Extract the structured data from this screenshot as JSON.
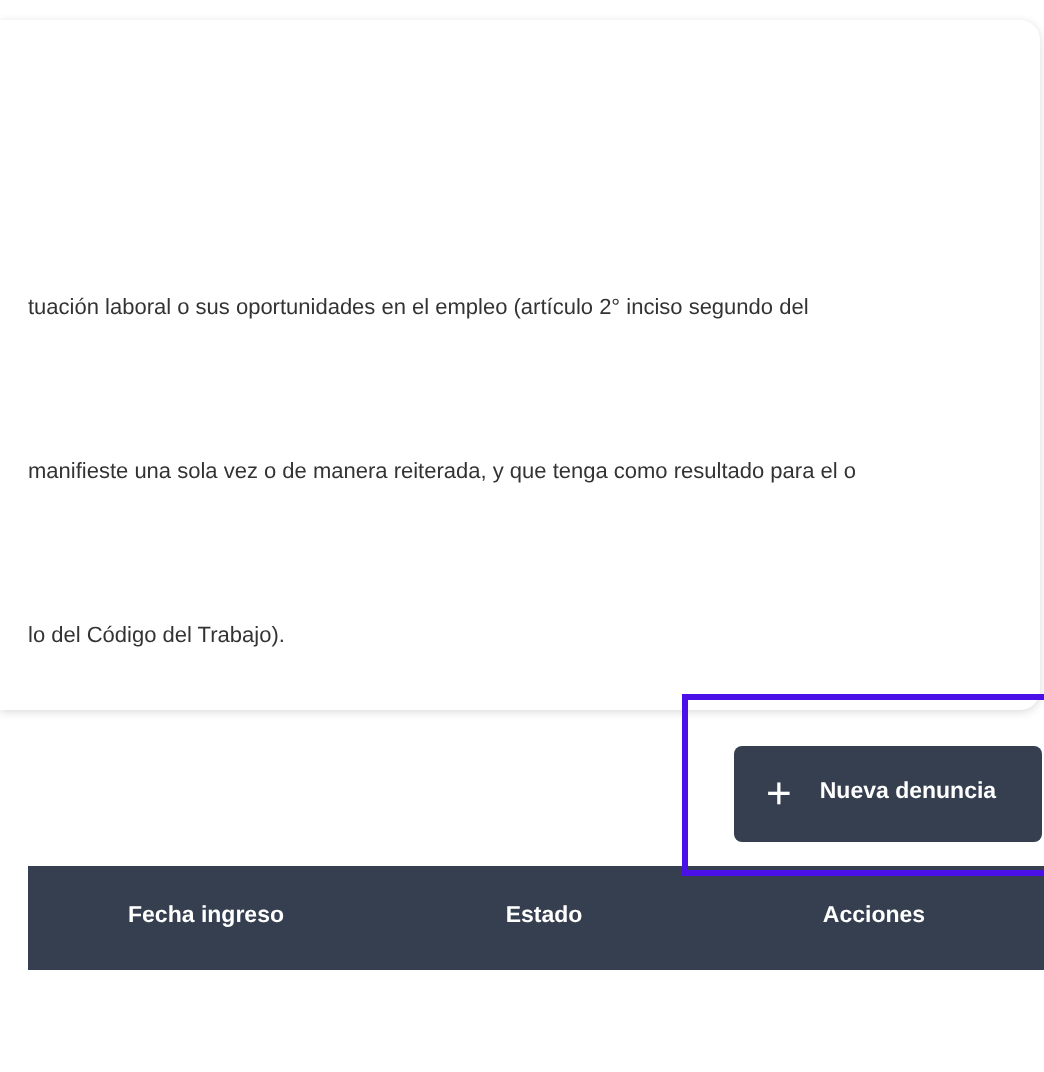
{
  "info_card": {
    "paragraphs": [
      "tuación laboral o sus oportunidades en el empleo (artículo 2° inciso segundo del",
      "manifieste una sola vez o de manera reiterada, y que tenga como resultado para el o",
      "lo del Código del Trabajo)."
    ]
  },
  "new_button": {
    "icon": "+",
    "label": "Nueva denuncia",
    "highlighted": true
  },
  "table": {
    "columns": [
      "Fecha ingreso",
      "Estado",
      "Acciones"
    ]
  }
}
